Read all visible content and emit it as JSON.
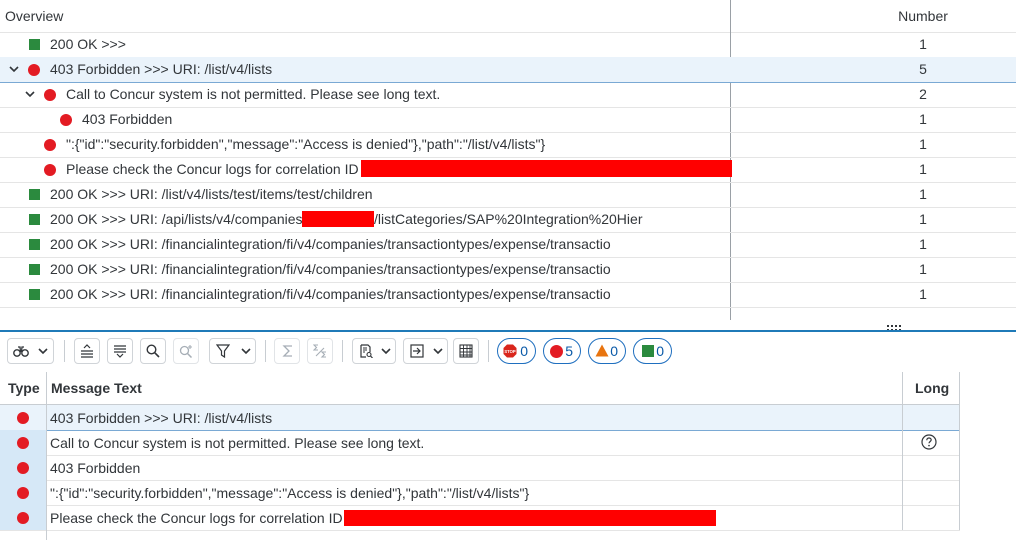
{
  "overview": {
    "columns": {
      "overview": "Overview",
      "number": "Number"
    },
    "rows": [
      {
        "text": "200  OK >>>",
        "number": "1",
        "status": "ok"
      },
      {
        "text": "403  Forbidden >>> URI: /list/v4/lists",
        "number": "5",
        "status": "error",
        "expanded": true
      },
      {
        "text": "Call to Concur system is not permitted. Please see long text.",
        "number": "2",
        "status": "error",
        "expanded": true
      },
      {
        "text": "403 Forbidden",
        "number": "1",
        "status": "error"
      },
      {
        "text": "\":{\"id\":\"security.forbidden\",\"message\":\"Access is denied\"},\"path\":\"/list/v4/lists\"}",
        "number": "1",
        "status": "error"
      },
      {
        "text": "Please check the Concur logs for correlation ID",
        "number": "1",
        "status": "error",
        "redacted": true
      },
      {
        "text": "200  OK >>> URI: /list/v4/lists/test/items/test/children",
        "number": "1",
        "status": "ok"
      },
      {
        "text_before": "200  OK >>> URI: /api/lists/v4/companies",
        "text_after": "/listCategories/SAP%20Integration%20Hier",
        "number": "1",
        "status": "ok",
        "redacted": true
      },
      {
        "text": "200  OK >>> URI: /financialintegration/fi/v4/companies/transactiontypes/expense/transactio",
        "number": "1",
        "status": "ok"
      },
      {
        "text": "200  OK >>> URI: /financialintegration/fi/v4/companies/transactiontypes/expense/transactio",
        "number": "1",
        "status": "ok"
      },
      {
        "text": "200  OK >>> URI: /financialintegration/fi/v4/companies/transactiontypes/expense/transactio",
        "number": "1",
        "status": "ok"
      }
    ]
  },
  "toolbar": {
    "buttons": [
      "binoculars-icon",
      "collapse-all-icon",
      "expand-all-icon",
      "find-icon",
      "find-next-icon",
      "filter-icon",
      "sum-icon",
      "subtotal-icon",
      "print-preview-icon",
      "export-icon",
      "layout-grid-icon"
    ],
    "counts": {
      "stop": "0",
      "error": "5",
      "warning": "0",
      "success": "0"
    },
    "colors": {
      "error": "#e31b23",
      "warning": "#e8740f",
      "success": "#2b8a3e",
      "stop": "#d9261c"
    }
  },
  "messages": {
    "columns": {
      "type": "Type",
      "message_text": "Message Text",
      "long": "Long"
    },
    "rows": [
      {
        "text": "403  Forbidden >>> URI: /list/v4/lists",
        "type": "error",
        "has_long": false
      },
      {
        "text": "Call to Concur system is not permitted. Please see long text.",
        "type": "error",
        "has_long": true
      },
      {
        "text": "403 Forbidden",
        "type": "error",
        "has_long": false
      },
      {
        "text": "\":{\"id\":\"security.forbidden\",\"message\":\"Access is denied\"},\"path\":\"/list/v4/lists\"}",
        "type": "error",
        "has_long": false
      },
      {
        "text": "Please check the Concur logs for correlation ID",
        "type": "error",
        "has_long": false,
        "redacted": true
      }
    ]
  }
}
